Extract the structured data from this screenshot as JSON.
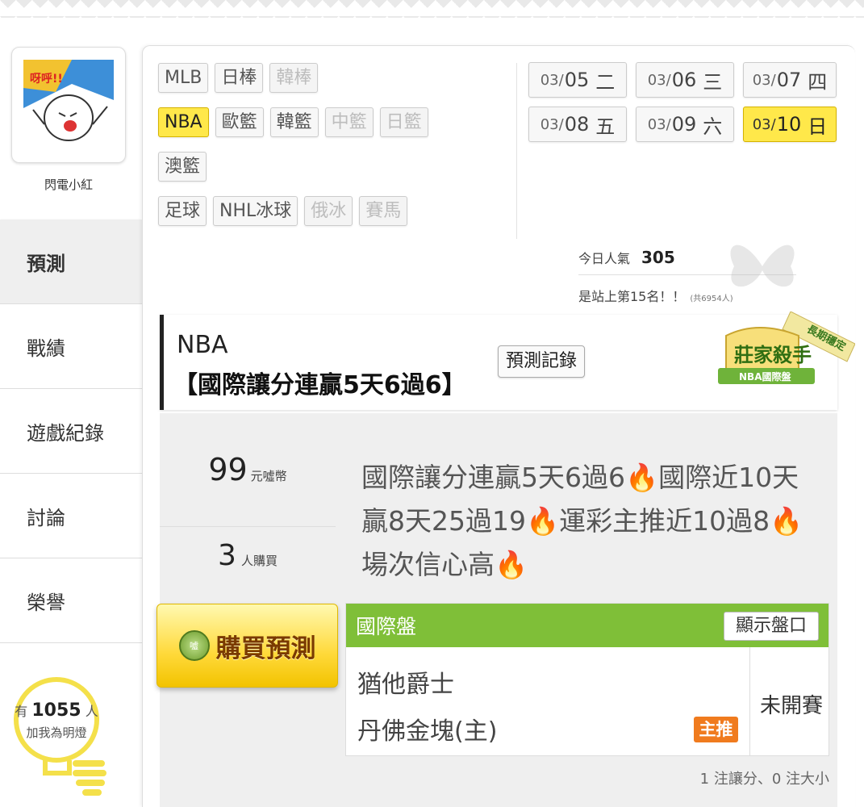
{
  "user": {
    "name": "閃電小紅",
    "avatar_caption": "呀呼!!"
  },
  "side_nav": [
    {
      "label": "預測",
      "active": true
    },
    {
      "label": "戰績",
      "active": false
    },
    {
      "label": "遊戲紀錄",
      "active": false
    },
    {
      "label": "討論",
      "active": false
    },
    {
      "label": "榮譽",
      "active": false
    }
  ],
  "bulb": {
    "prefix": "有",
    "count": "1055",
    "suffix": "人",
    "label": "加我為明燈"
  },
  "sport_tags": [
    [
      {
        "label": "MLB",
        "state": "normal"
      },
      {
        "label": "日棒",
        "state": "normal"
      },
      {
        "label": "韓棒",
        "state": "disabled"
      }
    ],
    [
      {
        "label": "NBA",
        "state": "active"
      },
      {
        "label": "歐籃",
        "state": "normal"
      },
      {
        "label": "韓籃",
        "state": "normal"
      },
      {
        "label": "中籃",
        "state": "disabled"
      },
      {
        "label": "日籃",
        "state": "disabled"
      }
    ],
    [
      {
        "label": "澳籃",
        "state": "normal"
      }
    ],
    [
      {
        "label": "足球",
        "state": "normal"
      },
      {
        "label": "NHL冰球",
        "state": "normal"
      },
      {
        "label": "俄冰",
        "state": "disabled"
      },
      {
        "label": "賽馬",
        "state": "disabled"
      }
    ]
  ],
  "dates": [
    {
      "month": "03/",
      "day": "05",
      "weekday": "二",
      "active": false
    },
    {
      "month": "03/",
      "day": "06",
      "weekday": "三",
      "active": false
    },
    {
      "month": "03/",
      "day": "07",
      "weekday": "四",
      "active": false
    },
    {
      "month": "03/",
      "day": "08",
      "weekday": "五",
      "active": false
    },
    {
      "month": "03/",
      "day": "09",
      "weekday": "六",
      "active": false
    },
    {
      "month": "03/",
      "day": "10",
      "weekday": "日",
      "active": true
    }
  ],
  "stats": {
    "popularity_label": "今日人氣",
    "popularity_value": "305",
    "rank_text": "是站上第15名！！",
    "rank_total": "(共6954人)"
  },
  "prediction": {
    "league": "NBA",
    "title": "【國際讓分連贏5天6過6】",
    "record_button": "預測記錄",
    "badge_title": "莊家殺手",
    "badge_sub": "NBA國際盤",
    "badge_ribbon": "長期穩定",
    "price": "99",
    "price_unit": "元噓幣",
    "buyers": "3",
    "buyers_unit": "人購買",
    "description": [
      "國際讓分連贏5天6過6",
      "國際近10天贏8天25過19",
      "運彩主推近10過8",
      "場次信心高"
    ],
    "buy_button": "購買預測",
    "coin_label": "噓"
  },
  "game": {
    "market": "國際盤",
    "show_line_button": "顯示盤口",
    "away_team": "猶他爵士",
    "home_team": "丹佛金塊(主)",
    "main_badge": "主推",
    "status": "未開賽"
  },
  "summary": "1 注讓分、0 注大小",
  "colors": {
    "accent_yellow": "#ffe84a",
    "green_header": "#7fbf38",
    "orange_badge": "#f07b1e",
    "fire": "#ff5a1f"
  }
}
